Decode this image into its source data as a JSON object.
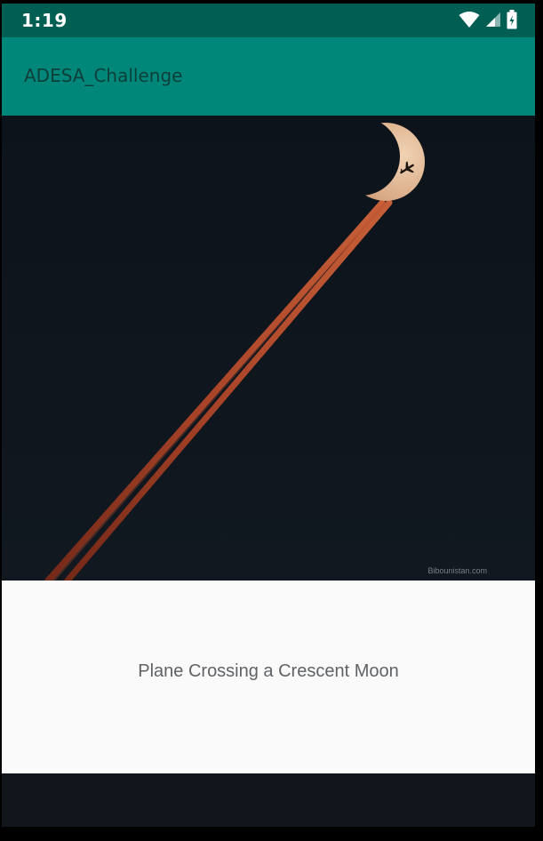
{
  "status_bar": {
    "time": "1:19",
    "icons": [
      "wifi-icon",
      "cell-signal-icon",
      "battery-charging-icon"
    ]
  },
  "app_bar": {
    "title": "ADESA_Challenge"
  },
  "image": {
    "watermark": "Bibounistan.com"
  },
  "caption": {
    "text": "Plane Crossing a Crescent Moon"
  },
  "colors": {
    "status_bar": "#005e53",
    "app_bar": "#00877a",
    "card_background": "#fafafa",
    "night_sky": "#0e141b"
  }
}
